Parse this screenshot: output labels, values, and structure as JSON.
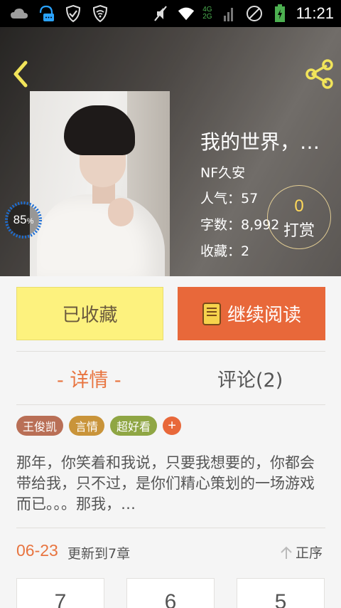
{
  "status_bar": {
    "time": "11:21",
    "network_top": "4G",
    "network_bottom": "2G",
    "icons": [
      "cloud-icon",
      "chat-notification-icon",
      "shield-check-icon",
      "wifi-shield-icon",
      "mute-icon",
      "wifi-icon",
      "cellular-signal-icon",
      "no-sim-icon",
      "battery-charging-icon"
    ]
  },
  "book": {
    "title": "我的世界，…",
    "author": "NF久安",
    "popularity": "人气：57",
    "word_count": "字数：8,992",
    "favorites": "收藏：2",
    "read_progress": "85",
    "read_progress_unit": "%"
  },
  "tip": {
    "count": "0",
    "label": "打赏"
  },
  "actions": {
    "favorited_label": "已收藏",
    "continue_label": "继续阅读"
  },
  "tabs": {
    "detail": "- 详情 -",
    "comments": "评论(2)"
  },
  "tags": [
    {
      "label": "王俊凯",
      "color": "#b96f56"
    },
    {
      "label": "言情",
      "color": "#c9943a"
    },
    {
      "label": "超好看",
      "color": "#8fa644"
    }
  ],
  "tag_add_label": "+",
  "description": "那年，你笑着和我说，只要我想要的，你都会带给我，只不过，是你们精心策划的一场游戏而已。。。那我，…",
  "update": {
    "date": "06-23",
    "text": "更新到7章",
    "sort_label": "正序"
  },
  "chapters": [
    "7",
    "6",
    "5"
  ],
  "colors": {
    "accent": "#e8683a",
    "favorite_bg": "#fdf27e",
    "back_arrow": "#f1e45a",
    "share_icon": "#f1e45a"
  }
}
